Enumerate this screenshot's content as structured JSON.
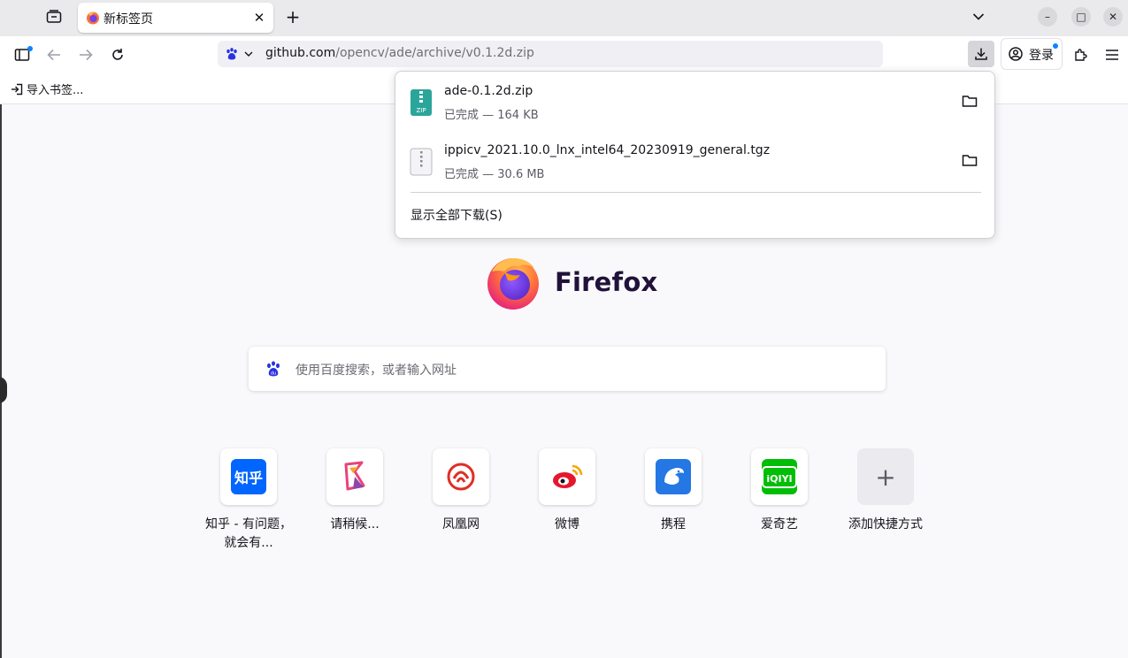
{
  "tabstrip": {
    "active_tab_title": "新标签页",
    "new_tab_symbol": "+",
    "close_symbol": "✕"
  },
  "window_controls": {
    "minimize": "–",
    "maximize": "□",
    "close": "✕"
  },
  "navbar": {
    "url_host": "github.com",
    "url_path": "/opencv/ade/archive/v0.1.2d.zip",
    "login_label": "登录"
  },
  "bookmarks": {
    "import_label": "导入书签..."
  },
  "downloads": {
    "items": [
      {
        "name": "ade-0.1.2d.zip",
        "status": "已完成 — 164 KB",
        "icon": "zip-file-icon"
      },
      {
        "name": "ippicv_2021.10.0_lnx_intel64_20230919_general.tgz",
        "status": "已完成 — 30.6 MB",
        "icon": "archive-file-icon"
      }
    ],
    "show_all_label": "显示全部下载(S)"
  },
  "newtab": {
    "brand": "Firefox",
    "search_placeholder": "使用百度搜索，或者输入网址",
    "top_sites": [
      {
        "label": "知乎 - 有问题，就会有...",
        "icon": "zhihu-icon",
        "icon_text": "知乎",
        "color": "#0066ff"
      },
      {
        "label": "请稍候...",
        "icon": "qingshaohou-icon",
        "icon_text": "",
        "color": "#e8437a"
      },
      {
        "label": "凤凰网",
        "icon": "ifeng-icon",
        "icon_text": "",
        "color": "#e02e24"
      },
      {
        "label": "微博",
        "icon": "weibo-icon",
        "icon_text": "",
        "color": "#e6162d"
      },
      {
        "label": "携程",
        "icon": "ctrip-icon",
        "icon_text": "",
        "color": "#2577e3"
      },
      {
        "label": "爱奇艺",
        "icon": "iqiyi-icon",
        "icon_text": "iQIYI",
        "color": "#00be06"
      },
      {
        "label": "添加快捷方式",
        "icon": "plus-icon",
        "icon_text": "+",
        "color": "#5b5b66"
      }
    ]
  },
  "colors": {
    "accent": "#0a84ff",
    "tabstrip_bg": "#eaeaed",
    "page_bg": "#f9f9fb"
  }
}
